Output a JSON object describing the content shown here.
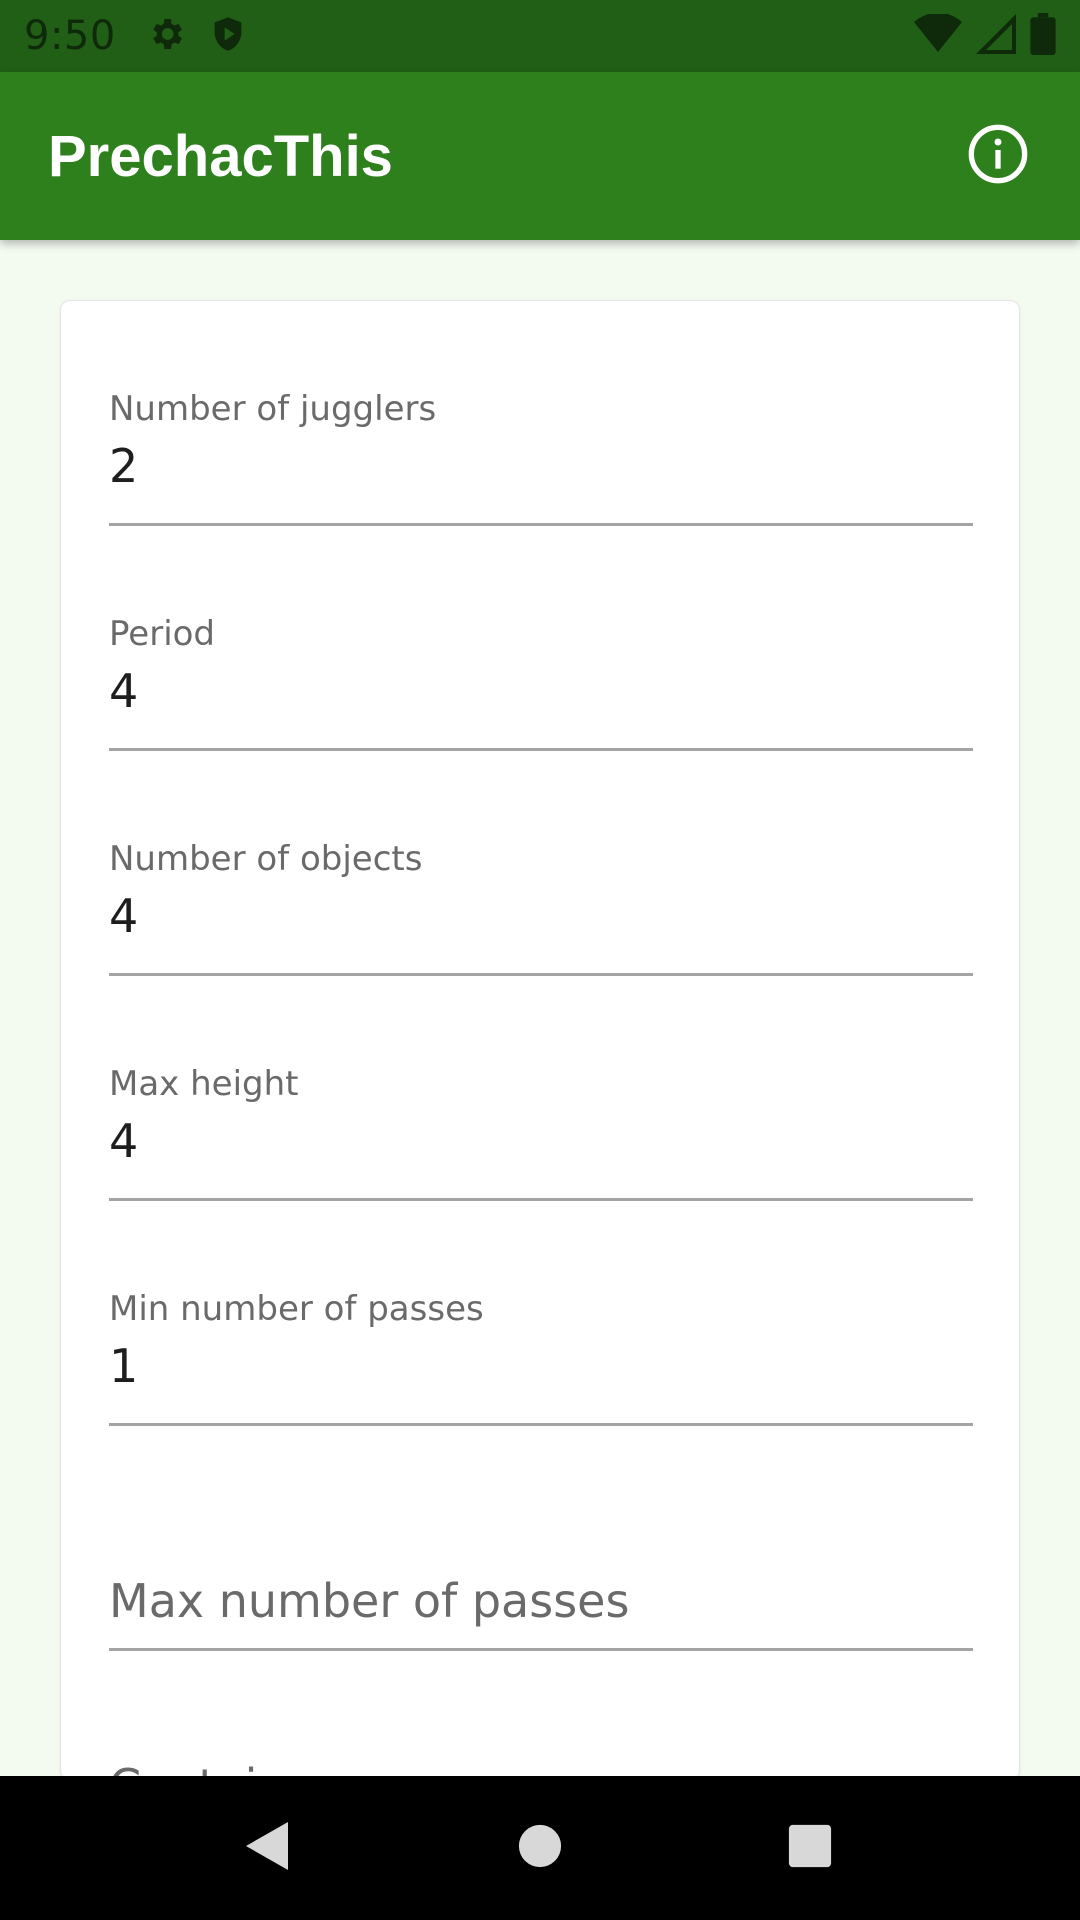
{
  "status_bar": {
    "time": "9:50",
    "left_icons": [
      "gear-icon",
      "shield-play-icon"
    ],
    "right_icons": [
      "wifi-icon",
      "signal-icon",
      "battery-icon"
    ]
  },
  "app_bar": {
    "title": "PrechacThis",
    "action_icon": "info-icon",
    "color": "#2d801c"
  },
  "form": {
    "fields": [
      {
        "label": "Number of jugglers",
        "value": "2"
      },
      {
        "label": "Period",
        "value": "4"
      },
      {
        "label": "Number of objects",
        "value": "4"
      },
      {
        "label": "Max height",
        "value": "4"
      },
      {
        "label": "Min number of passes",
        "value": "1"
      },
      {
        "label": "",
        "value": "",
        "placeholder": "Max number of passes"
      }
    ],
    "next_field_label_partial": "Contain"
  },
  "nav_bar": {
    "icons": [
      "back-icon",
      "home-icon",
      "recents-icon"
    ]
  },
  "colors": {
    "status_bar": "#215e16",
    "app_bar": "#2d801c",
    "background": "#f3fbf1"
  }
}
